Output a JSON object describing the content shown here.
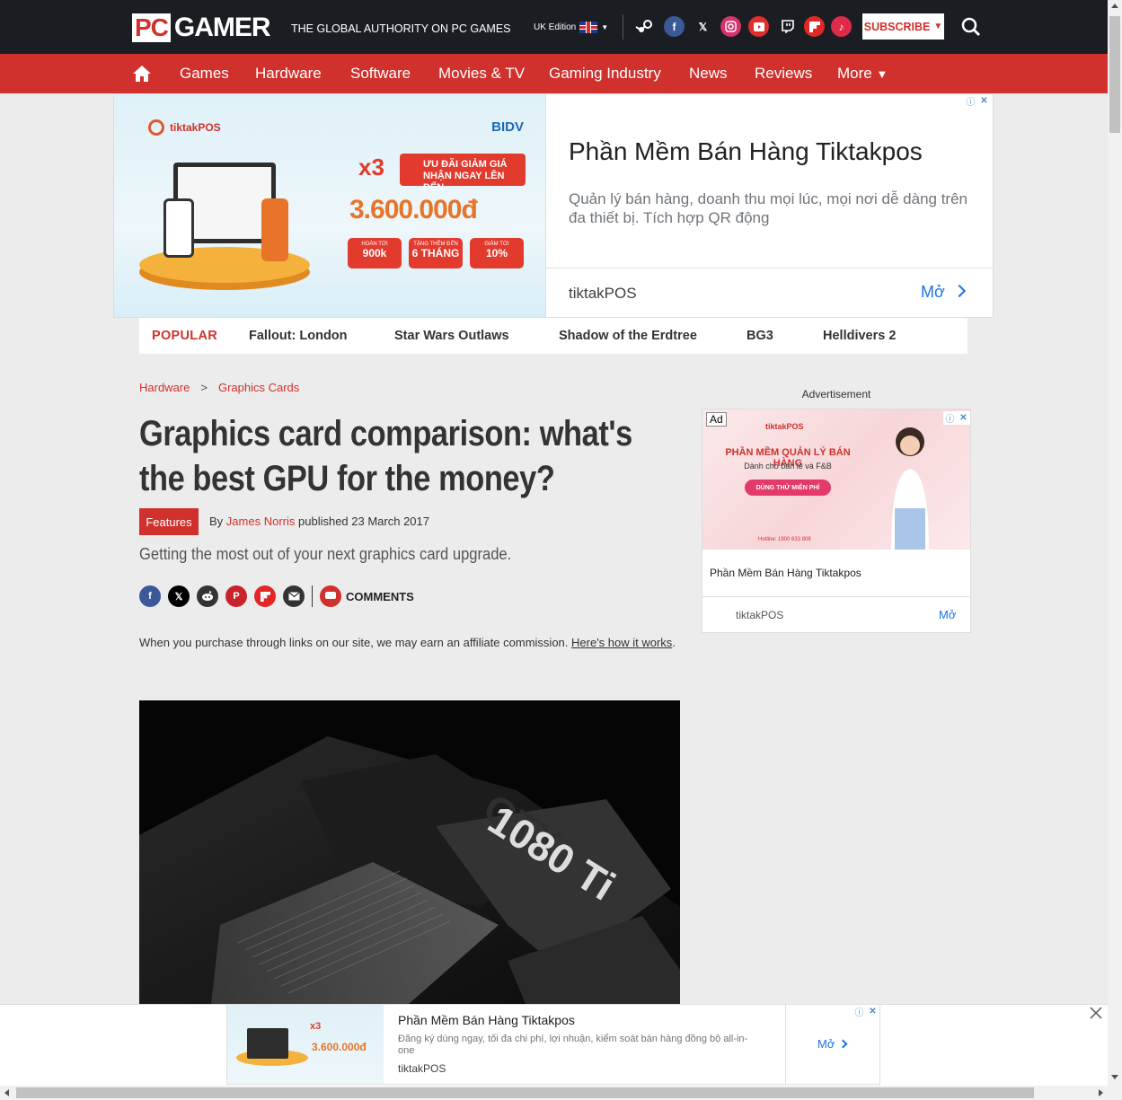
{
  "header": {
    "logo_pc": "PC",
    "logo_gamer": "GAMER",
    "tagline": "THE GLOBAL AUTHORITY ON PC GAMES",
    "edition": "UK Edition",
    "subscribe_label": "SUBSCRIBE",
    "social_icons": [
      "steam-icon",
      "facebook-icon",
      "x-icon",
      "instagram-icon",
      "youtube-icon",
      "twitch-icon",
      "flipboard-icon",
      "tiktok-icon"
    ],
    "colors": {
      "bar": "#1a1e23",
      "accent": "#d0312d"
    }
  },
  "nav": {
    "items": [
      "Games",
      "Hardware",
      "Software",
      "Movies & TV",
      "Gaming Industry",
      "News",
      "Reviews",
      "More"
    ]
  },
  "top_ad": {
    "brand": "tiktakPOS",
    "partner": "BIDV",
    "multiplier": "x3",
    "promo_line1": "ƯU ĐÃI GIẢM GIÁ",
    "promo_line2": "NHẬN NGAY LÊN ĐẾN",
    "amount": "3.600.000đ",
    "chips": [
      {
        "caption": "HOÀN TỚI",
        "value": "900k"
      },
      {
        "caption": "TẶNG THÊM ĐẾN",
        "value": "6 THÁNG"
      },
      {
        "caption": "GIẢM TỚI",
        "value": "10%"
      }
    ],
    "title": "Phần Mềm Bán Hàng Tiktakpos",
    "description": "Quản lý bán hàng, doanh thu mọi lúc, mọi nơi dễ dàng trên đa thiết bị. Tích hợp QR động",
    "advertiser": "tiktakPOS",
    "open_label": "Mở"
  },
  "popular": {
    "label": "POPULAR",
    "items": [
      "Fallout: London",
      "Star Wars Outlaws",
      "Shadow of the Erdtree",
      "BG3",
      "Helldivers 2"
    ]
  },
  "article": {
    "breadcrumb": [
      "Hardware",
      "Graphics Cards"
    ],
    "breadcrumb_sep": ">",
    "headline_line1": "Graphics card comparison: what's",
    "headline_line2": "the best GPU for the money?",
    "tag": "Features",
    "by": "By",
    "author": "James Norris",
    "published": "published 23 March 2017",
    "standfirst": "Getting the most out of your next graphics card upgrade.",
    "share_icons": [
      "facebook-icon",
      "x-icon",
      "reddit-icon",
      "pinterest-icon",
      "flipboard-icon",
      "email-icon"
    ],
    "comments_label": "COMMENTS",
    "affiliate_text": "When you purchase through links on our site, we may earn an affiliate commission.",
    "affiliate_link": "Here's how it works",
    "affiliate_end": ".",
    "hero_text": "1080 Ti",
    "hero_text_faint": "GTX"
  },
  "sidebar_ad": {
    "label": "Advertisement",
    "ad_tag": "Ad",
    "brand": "tiktakPOS",
    "headline": "PHẦN MỀM QUẢN LÝ BÁN HÀNG",
    "subline": "Dành cho bán lẻ và F&B",
    "cta": "DÙNG THỬ MIỄN PHÍ",
    "hotline": "Hotline: 1900 633 808",
    "title": "Phần Mềm Bán Hàng Tiktakpos",
    "advertiser": "tiktakPOS",
    "open_label": "Mở"
  },
  "bottom_ad": {
    "title": "Phần Mềm Bán Hàng Tiktakpos",
    "description": "Đăng ký dùng ngay, tối đa chi phí, lợi nhuận, kiểm soát bán hàng đồng bộ all-in- one",
    "advertiser": "tiktakPOS",
    "open_label": "Mở",
    "multiplier": "x3",
    "amount": "3.600.000đ"
  }
}
